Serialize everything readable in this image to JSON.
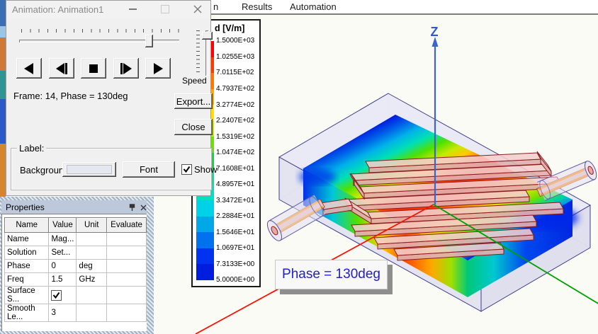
{
  "menu": {
    "fragment": "n",
    "items": [
      {
        "label": "Results"
      },
      {
        "label": "Automation"
      }
    ]
  },
  "animation_dialog": {
    "title": "Animation: Animation1",
    "frame_text": "Frame: 14, Phase = 130deg",
    "speed_label": "Speed",
    "export_label": "Export...",
    "close_label": "Close",
    "label_group": {
      "title": "Label:",
      "background_label": "Background:",
      "font_label": "Font",
      "show_label": "Show",
      "show_checked": true
    },
    "playback_icons": [
      "play-reverse",
      "step-reverse",
      "stop",
      "step-forward",
      "play-forward"
    ]
  },
  "properties_panel": {
    "title": "Properties",
    "columns": [
      "Name",
      "Value",
      "Unit",
      "Evaluate"
    ],
    "rows": [
      {
        "name": "Name",
        "value": "Mag...",
        "unit": "",
        "evaluate": ""
      },
      {
        "name": "Solution",
        "value": "Set...",
        "unit": "",
        "evaluate": ""
      },
      {
        "name": "Phase",
        "value": "0",
        "unit": "deg",
        "evaluate": ""
      },
      {
        "name": "Freq",
        "value": "1.5",
        "unit": "GHz",
        "evaluate": ""
      },
      {
        "name": "Surface S...",
        "value": "",
        "unit": "",
        "evaluate": "",
        "checkbox": true
      },
      {
        "name": "Smooth Le...",
        "value": "3",
        "unit": "",
        "evaluate": ""
      }
    ]
  },
  "legend": {
    "title": "d [V/m]",
    "values": [
      "1.5000E+03",
      "1.0255E+03",
      "7.0115E+02",
      "4.7937E+02",
      "3.2774E+02",
      "2.2407E+02",
      "1.5319E+02",
      "1.0474E+02",
      "7.1608E+01",
      "4.8957E+01",
      "3.3472E+01",
      "2.2884E+01",
      "1.5646E+01",
      "1.0697E+01",
      "7.3133E+00",
      "5.0000E+00"
    ],
    "colors": [
      "#FF0000",
      "#FF3C00",
      "#FF7800",
      "#FFAA00",
      "#FFE000",
      "#C8E800",
      "#6CE000",
      "#00E038",
      "#00E68C",
      "#00E0C0",
      "#00D2E6",
      "#00A8E8",
      "#0072F0",
      "#0032F0",
      "#001CDC"
    ]
  },
  "viewport": {
    "z_axis_label": "Z",
    "phase_overlay": "Phase = 130deg",
    "axis_colors": {
      "x": "#FF1000",
      "y": "#00A000",
      "z": "#3A66CC"
    }
  },
  "icons": {
    "minimize": "-",
    "maximize": "[]",
    "close": "x",
    "pin": "pushpin",
    "check": "v"
  }
}
